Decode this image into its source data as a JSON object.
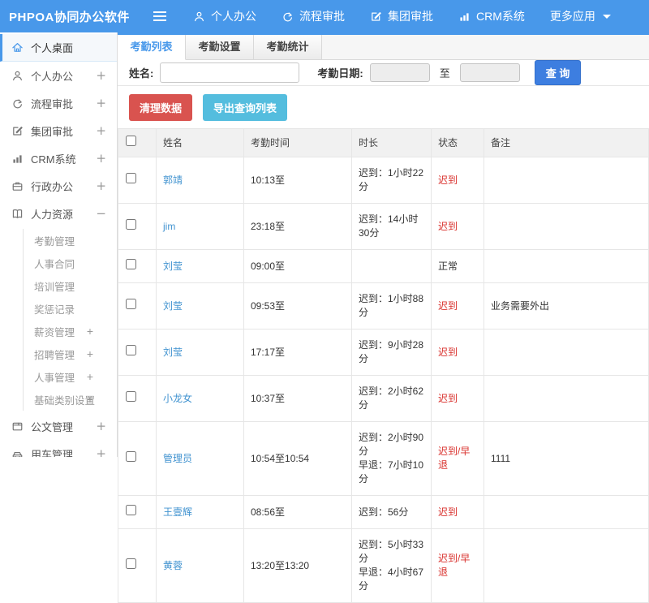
{
  "colors": {
    "topbar_blue": "#4898ea",
    "search_button_blue": "#3d7ee0",
    "danger_red": "#d9534f",
    "info_teal": "#54bdde",
    "status_red": "#d9302c",
    "link_blue": "#4193d0"
  },
  "topbar": {
    "title": "PHPOA协同办公软件",
    "menu_icon": "hamburger-icon",
    "nav": [
      {
        "name": "personal-office",
        "icon": "user-icon",
        "label": "个人办公",
        "caret": false
      },
      {
        "name": "workflow-approval",
        "icon": "flow-icon",
        "label": "流程审批",
        "caret": false
      },
      {
        "name": "group-approval",
        "icon": "edit-icon",
        "label": "集团审批",
        "caret": false
      },
      {
        "name": "crm-system",
        "icon": "chart-icon",
        "label": "CRM系统",
        "caret": false
      },
      {
        "name": "more-apps",
        "icon": "",
        "label": "更多应用",
        "caret": true
      }
    ]
  },
  "sidebar": {
    "items": [
      {
        "name": "personal-desktop",
        "icon": "home-icon",
        "label": "个人桌面",
        "expand": "",
        "active": true
      },
      {
        "name": "personal-office",
        "icon": "user-icon",
        "label": "个人办公",
        "expand": "+"
      },
      {
        "name": "workflow-approval",
        "icon": "flow-icon",
        "label": "流程审批",
        "expand": "+"
      },
      {
        "name": "group-approval",
        "icon": "edit-icon",
        "label": "集团审批",
        "expand": "+"
      },
      {
        "name": "crm-system",
        "icon": "chart-icon",
        "label": "CRM系统",
        "expand": "+"
      },
      {
        "name": "admin-office",
        "icon": "briefcase-icon",
        "label": "行政办公",
        "expand": "+"
      },
      {
        "name": "human-resources",
        "icon": "book-icon",
        "label": "人力资源",
        "expand": "−",
        "children": [
          {
            "name": "attendance-management",
            "label": "考勤管理",
            "expand": ""
          },
          {
            "name": "personnel-contract",
            "label": "人事合同",
            "expand": ""
          },
          {
            "name": "training-management",
            "label": "培训管理",
            "expand": ""
          },
          {
            "name": "reward-punishment-record",
            "label": "奖惩记录",
            "expand": ""
          },
          {
            "name": "salary-management",
            "label": "薪资管理",
            "expand": "+"
          },
          {
            "name": "recruitment-management",
            "label": "招聘管理",
            "expand": "+"
          },
          {
            "name": "personnel-management",
            "label": "人事管理",
            "expand": "+"
          },
          {
            "name": "basic-category-settings",
            "label": "基础类别设置",
            "expand": "+"
          }
        ]
      },
      {
        "name": "document-management",
        "icon": "doc-icon",
        "label": "公文管理",
        "expand": "+"
      },
      {
        "name": "vehicle-management",
        "icon": "car-icon",
        "label": "用车管理",
        "expand": "+"
      }
    ]
  },
  "tabs": [
    {
      "name": "tab-attendance-list",
      "label": "考勤列表",
      "active": true
    },
    {
      "name": "tab-attendance-setup",
      "label": "考勤设置",
      "active": false
    },
    {
      "name": "tab-attendance-stats",
      "label": "考勤统计",
      "active": false
    }
  ],
  "filter": {
    "name_label": "姓名:",
    "date_label": "考勤日期:",
    "to_label": "至",
    "search_button": "查 询"
  },
  "actions": {
    "clean_button": "清理数据",
    "export_button": "导出查询列表"
  },
  "table": {
    "headers": [
      "姓名",
      "考勤时间",
      "时长",
      "状态",
      "备注"
    ],
    "rows": [
      {
        "name": "郭靖",
        "time": "10:13至",
        "duration": [
          "迟到：1小时22分"
        ],
        "status": "迟到",
        "status_type": "late",
        "remark": ""
      },
      {
        "name": "jim",
        "time": "23:18至",
        "duration": [
          "迟到：14小时30分"
        ],
        "status": "迟到",
        "status_type": "late",
        "remark": ""
      },
      {
        "name": "刘莹",
        "time": "09:00至",
        "duration": [],
        "status": "正常",
        "status_type": "normal",
        "remark": ""
      },
      {
        "name": "刘莹",
        "time": "09:53至",
        "duration": [
          "迟到：1小时88分"
        ],
        "status": "迟到",
        "status_type": "late",
        "remark": "业务需要外出"
      },
      {
        "name": "刘莹",
        "time": "17:17至",
        "duration": [
          "迟到：9小时28分"
        ],
        "status": "迟到",
        "status_type": "late",
        "remark": ""
      },
      {
        "name": "小龙女",
        "time": "10:37至",
        "duration": [
          "迟到：2小时62分"
        ],
        "status": "迟到",
        "status_type": "late",
        "remark": ""
      },
      {
        "name": "管理员",
        "time": "10:54至10:54",
        "duration": [
          "迟到：2小时90分",
          "早退：7小时10分"
        ],
        "status": "迟到/早退",
        "status_type": "late",
        "remark": "1111"
      },
      {
        "name": "王壹辉",
        "time": "08:56至",
        "duration": [
          "迟到：56分"
        ],
        "status": "迟到",
        "status_type": "late",
        "remark": ""
      },
      {
        "name": "黄蓉",
        "time": "13:20至13:20",
        "duration": [
          "迟到：5小时33分",
          "早退：4小时67分"
        ],
        "status": "迟到/早退",
        "status_type": "late",
        "remark": ""
      }
    ]
  }
}
